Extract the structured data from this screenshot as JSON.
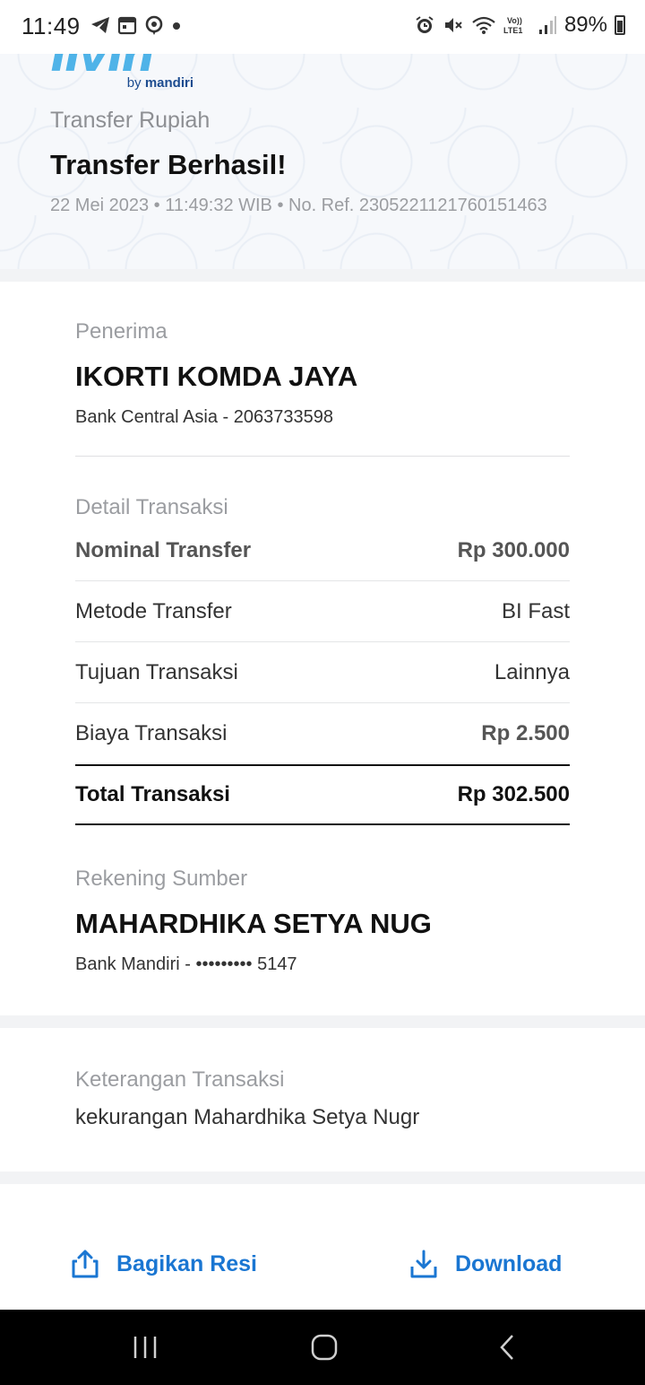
{
  "status_bar": {
    "time": "11:49",
    "battery_percent": "89%",
    "left_icons": [
      "telegram-icon",
      "calendar-icon",
      "vpn-icon",
      "dot-icon"
    ],
    "right_icons": [
      "alarm-icon",
      "mute-icon",
      "wifi-icon",
      "volte-icon",
      "signal-icon",
      "battery-icon"
    ]
  },
  "brand": {
    "logo_word": "livin",
    "by": "by",
    "bank": "mandiri",
    "accent": "#4fb3e8"
  },
  "header": {
    "subtitle": "Transfer Rupiah",
    "title": "Transfer Berhasil!",
    "meta": "22 Mei 2023 • 11:49:32 WIB • No. Ref. 2305221121760151463"
  },
  "recipient": {
    "label": "Penerima",
    "name": "IKORTI KOMDA JAYA",
    "account": "Bank Central Asia - 2063733598"
  },
  "transaction": {
    "label": "Detail Transaksi",
    "rows": [
      {
        "label": "Nominal Transfer",
        "value": "Rp 300.000"
      },
      {
        "label": "Metode Transfer",
        "value": "BI Fast"
      },
      {
        "label": "Tujuan Transaksi",
        "value": "Lainnya"
      },
      {
        "label": "Biaya Transaksi",
        "value": "Rp 2.500"
      }
    ],
    "total_label": "Total Transaksi",
    "total_value": "Rp 302.500"
  },
  "source": {
    "label": "Rekening Sumber",
    "name": "MAHARDHIKA SETYA NUG",
    "account": "Bank Mandiri - ••••••••• 5147"
  },
  "notes": {
    "label": "Keterangan Transaksi",
    "text": "kekurangan Mahardhika Setya Nugr"
  },
  "actions": {
    "share_label": "Bagikan Resi",
    "download_label": "Download",
    "color": "#1a76d2"
  },
  "navbar": {
    "buttons": [
      "recents-icon",
      "home-icon",
      "back-icon"
    ]
  }
}
